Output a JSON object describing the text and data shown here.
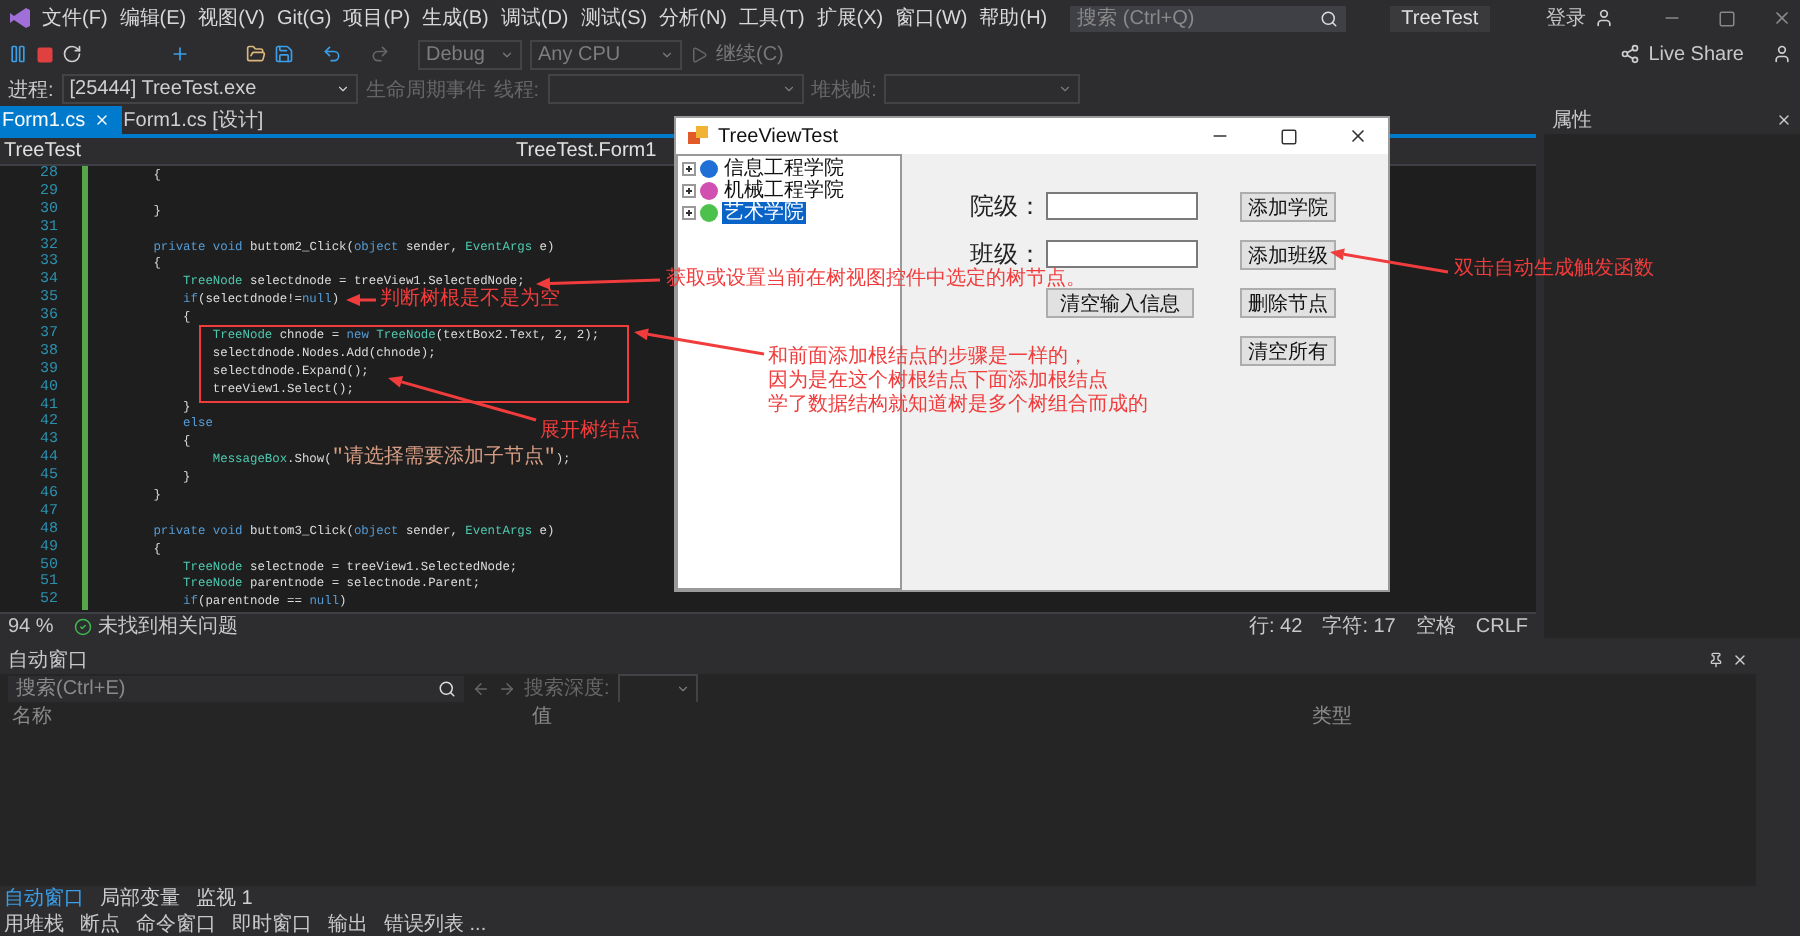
{
  "menu_bar": {
    "items": [
      "文件(F)",
      "编辑(E)",
      "视图(V)",
      "Git(G)",
      "项目(P)",
      "生成(B)",
      "调试(D)",
      "测试(S)",
      "分析(N)",
      "工具(T)",
      "扩展(X)",
      "窗口(W)",
      "帮助(H)"
    ],
    "search": {
      "placeholder": "搜索 (Ctrl+Q)"
    },
    "title": "TreeTest",
    "account": "登录"
  },
  "toolbar": {
    "configuration": "Debug",
    "platform": "Any CPU",
    "continue": "继续(C)",
    "live_share": "Live Share"
  },
  "debug_bar": {
    "label": "进程:",
    "process": "[25444] TreeTest.exe",
    "events": "生命周期事件",
    "thread_label": "线程:",
    "stack_label": "堆栈帧:"
  },
  "editor": {
    "tabs": [
      {
        "label": "Form1.cs",
        "selected": true
      },
      {
        "label": "Form1.cs [设计]",
        "selected": false
      }
    ],
    "project": "TreeTest",
    "class": "TreeTest.Form1",
    "lines": [
      {
        "number": "28",
        "segments": [
          {
            "kind": "plain",
            "text": "        {"
          }
        ]
      },
      {
        "number": "29"
      },
      {
        "number": "30",
        "segments": [
          {
            "kind": "plain",
            "text": "        }"
          }
        ]
      },
      {
        "number": "31"
      },
      {
        "number": "32",
        "segments": [
          {
            "kind": "kw",
            "text": "        private void "
          },
          {
            "kind": "plain",
            "text": "buttom2_Click("
          },
          {
            "kind": "kw",
            "text": "object"
          },
          {
            "kind": "plain",
            "text": " sender, "
          },
          {
            "kind": "type",
            "text": "EventArgs"
          },
          {
            "kind": "plain",
            "text": " e)"
          }
        ]
      },
      {
        "number": "33",
        "segments": [
          {
            "kind": "plain",
            "text": "        {"
          }
        ]
      },
      {
        "number": "34",
        "segments": [
          {
            "kind": "type",
            "text": "            TreeNode"
          },
          {
            "kind": "plain",
            "text": " selectdnode = treeView1.SelectedNode;"
          }
        ]
      },
      {
        "number": "35",
        "segments": [
          {
            "kind": "kw",
            "text": "            if"
          },
          {
            "kind": "plain",
            "text": "(selectdnode!="
          },
          {
            "kind": "kw",
            "text": "null"
          },
          {
            "kind": "plain",
            "text": ")"
          }
        ]
      },
      {
        "number": "36",
        "segments": [
          {
            "kind": "plain",
            "text": "            {"
          }
        ]
      },
      {
        "number": "37",
        "segments": [
          {
            "kind": "type",
            "text": "                TreeNode"
          },
          {
            "kind": "plain",
            "text": " chnode = "
          },
          {
            "kind": "kw",
            "text": "new "
          },
          {
            "kind": "type",
            "text": "TreeNode"
          },
          {
            "kind": "plain",
            "text": "(textBox2.Text, 2, 2);"
          }
        ]
      },
      {
        "number": "38",
        "segments": [
          {
            "kind": "plain",
            "text": "                selectdnode.Nodes.Add(chnode);"
          }
        ]
      },
      {
        "number": "39",
        "segments": [
          {
            "kind": "plain",
            "text": "                selectdnode.Expand();"
          }
        ]
      },
      {
        "number": "40",
        "segments": [
          {
            "kind": "plain",
            "text": "                treeView1.Select();"
          }
        ]
      },
      {
        "number": "41",
        "segments": [
          {
            "kind": "plain",
            "text": "            }"
          }
        ]
      },
      {
        "number": "42",
        "segments": [
          {
            "kind": "kw",
            "text": "            else"
          }
        ]
      },
      {
        "number": "43",
        "segments": [
          {
            "kind": "plain",
            "text": "            {"
          }
        ]
      },
      {
        "number": "44",
        "segments": [
          {
            "kind": "type",
            "text": "                MessageBox"
          },
          {
            "kind": "plain",
            "text": ".Show("
          },
          {
            "kind": "str",
            "text": "\"请选择需要添加子节点\""
          },
          {
            "kind": "plain",
            "text": ");"
          }
        ]
      },
      {
        "number": "45",
        "segments": [
          {
            "kind": "plain",
            "text": "            }"
          }
        ]
      },
      {
        "number": "46",
        "segments": [
          {
            "kind": "plain",
            "text": "        }"
          }
        ]
      },
      {
        "number": "47"
      },
      {
        "number": "48",
        "segments": [
          {
            "kind": "kw",
            "text": "        private void "
          },
          {
            "kind": "plain",
            "text": "buttom3_Click("
          },
          {
            "kind": "kw",
            "text": "object"
          },
          {
            "kind": "plain",
            "text": " sender, "
          },
          {
            "kind": "type",
            "text": "EventArgs"
          },
          {
            "kind": "plain",
            "text": " e)"
          }
        ]
      },
      {
        "number": "49",
        "segments": [
          {
            "kind": "plain",
            "text": "        {"
          }
        ]
      },
      {
        "number": "50",
        "segments": [
          {
            "kind": "type",
            "text": "            TreeNode"
          },
          {
            "kind": "plain",
            "text": " selectnode = treeView1.SelectedNode;"
          }
        ]
      },
      {
        "number": "51",
        "segments": [
          {
            "kind": "type",
            "text": "            TreeNode"
          },
          {
            "kind": "plain",
            "text": " parentnode = selectnode.Parent;"
          }
        ]
      },
      {
        "number": "52",
        "segments": [
          {
            "kind": "kw",
            "text": "            if"
          },
          {
            "kind": "plain",
            "text": "(parentnode == "
          },
          {
            "kind": "kw",
            "text": "null"
          },
          {
            "kind": "plain",
            "text": ")"
          }
        ]
      }
    ]
  },
  "editor_status": {
    "zoom": "94 %",
    "issues": "未找到相关问题",
    "line": "行: 42",
    "char": "字符: 17",
    "indent": "空格",
    "eol": "CRLF"
  },
  "properties": {
    "title": "属性"
  },
  "dialog": {
    "title": "TreeViewTest",
    "tree": [
      {
        "label": "信息工程学院",
        "color": "#1f6fd6",
        "selected": false
      },
      {
        "label": "机械工程学院",
        "color": "#d04fb0",
        "selected": false
      },
      {
        "label": "艺术学院",
        "color": "#4cc24c",
        "selected": true
      }
    ],
    "fields": [
      {
        "label": "院级："
      },
      {
        "label": "班级："
      }
    ],
    "buttons": [
      "添加学院",
      "添加班级",
      "清空输入信息",
      "删除节点",
      "清空所有"
    ]
  },
  "annotations": [
    {
      "kind": "single",
      "text": "获取或设置当前在树视图控件中选定的树节点。"
    },
    {
      "kind": "single",
      "text": "判断树根是不是为空"
    },
    {
      "kind": "single",
      "text": "展开树结点"
    },
    {
      "kind": "multi",
      "lines": [
        "和前面添加根结点的步骤是一样的，",
        "因为是在这个树根结点下面添加根结点",
        "学了数据结构就知道树是多个树组合而成的"
      ]
    },
    {
      "kind": "single",
      "text": "双击自动生成触发函数"
    }
  ],
  "autos_panel": {
    "title": "自动窗口",
    "search": {
      "placeholder": "搜索(Ctrl+E)"
    },
    "depth_label": "搜索深度:",
    "columns": [
      "名称",
      "值",
      "类型"
    ],
    "tabs": [
      {
        "label": "自动窗口",
        "selected": true
      },
      {
        "label": "局部变量",
        "selected": false
      },
      {
        "label": "监视 1",
        "selected": false
      }
    ]
  },
  "bottom_tabs": [
    "用堆栈",
    "断点",
    "命令窗口",
    "即时窗口",
    "输出",
    "错误列表 ..."
  ]
}
